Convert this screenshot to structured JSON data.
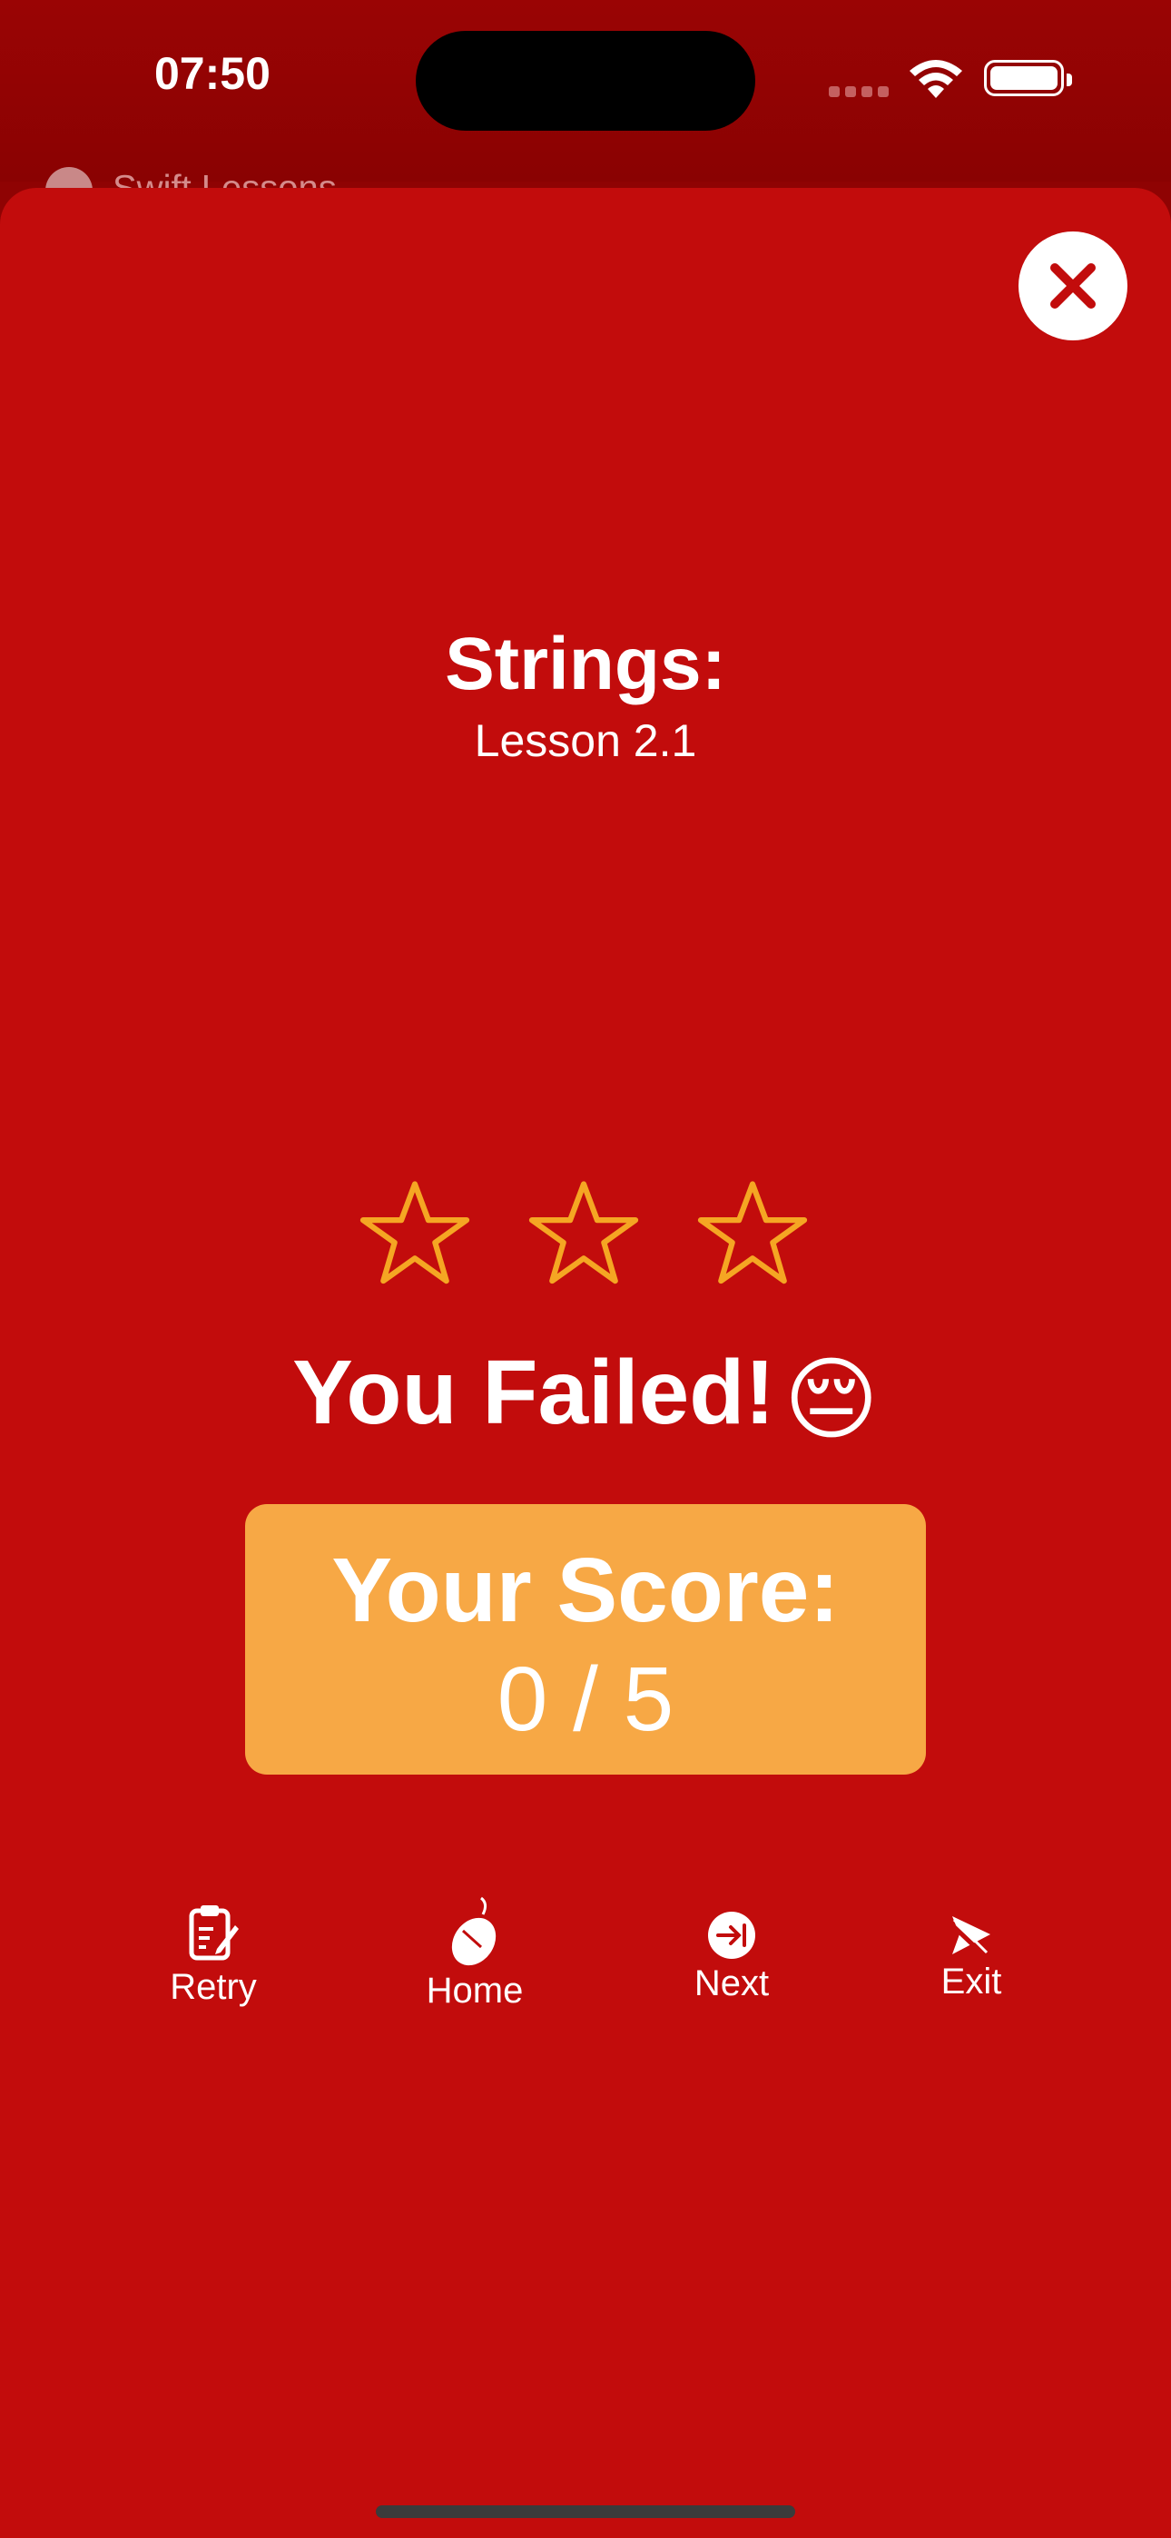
{
  "status_bar": {
    "time": "07:50"
  },
  "nav_back": {
    "label": "Swift Lessons"
  },
  "lesson": {
    "title": "Strings:",
    "subtitle": "Lesson 2.1"
  },
  "stars": {
    "earned": 0,
    "total": 3,
    "outline_color": "#f5a623"
  },
  "result": {
    "message": "You Failed!",
    "emoji": "😔"
  },
  "score": {
    "label": "Your Score:",
    "value": "0 / 5"
  },
  "actions": [
    {
      "label": "Retry",
      "icon": "clipboard-pencil-icon"
    },
    {
      "label": "Home",
      "icon": "mouse-icon"
    },
    {
      "label": "Next",
      "icon": "arrow-right-to-line-circle-icon"
    },
    {
      "label": "Exit",
      "icon": "paperplane-slash-icon"
    }
  ],
  "colors": {
    "background": "#c20c0c",
    "status_bar": "#8f0303",
    "score_box": "#f7a845",
    "text": "#ffffff"
  }
}
